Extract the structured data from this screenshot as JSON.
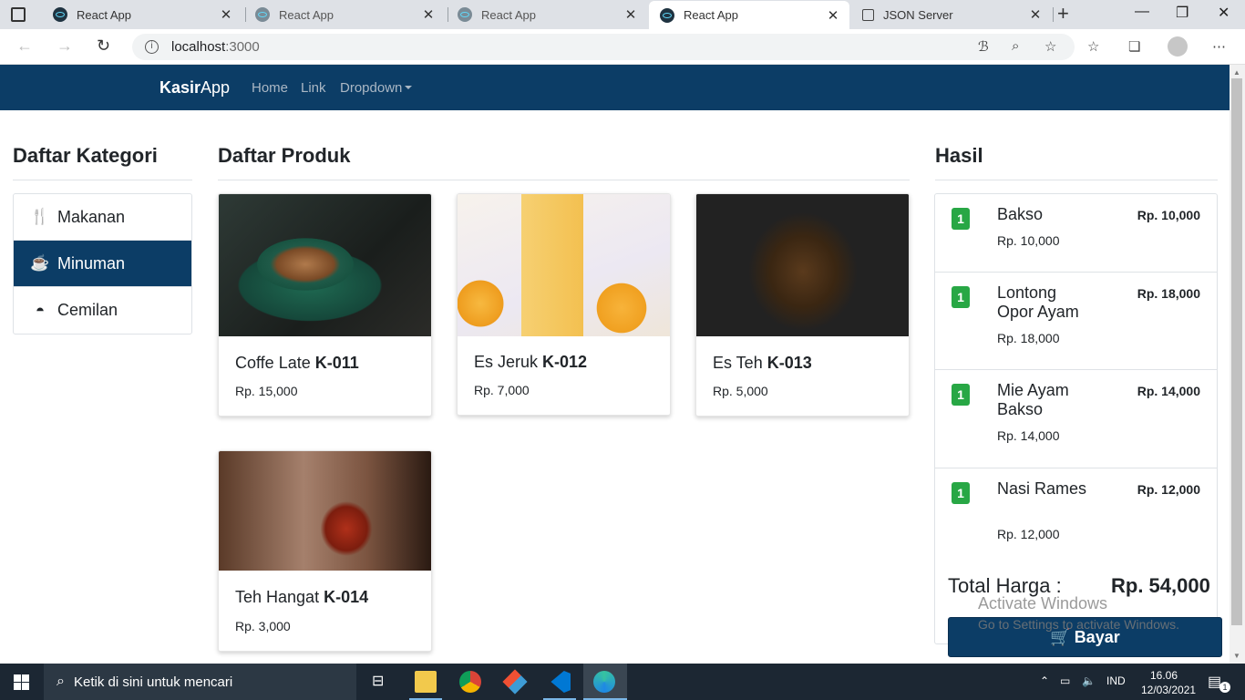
{
  "browser": {
    "tabs": [
      {
        "title": "React App"
      },
      {
        "title": "React App"
      },
      {
        "title": "React App"
      },
      {
        "title": "React App"
      },
      {
        "title": "JSON Server"
      }
    ],
    "url_host": "localhost",
    "url_port": ":3000"
  },
  "navbar": {
    "brand_bold": "Kasir",
    "brand_rest": "App",
    "links": [
      "Home",
      "Link",
      "Dropdown"
    ]
  },
  "kategori": {
    "title": "Daftar Kategori",
    "items": [
      {
        "label": "Makanan",
        "icon": "utensils-icon",
        "active": false
      },
      {
        "label": "Minuman",
        "icon": "coffee-icon",
        "active": true
      },
      {
        "label": "Cemilan",
        "icon": "cheese-icon",
        "active": false
      }
    ]
  },
  "produk": {
    "title": "Daftar Produk",
    "items": [
      {
        "name": "Coffe Late",
        "code": "K-011",
        "price": "Rp. 15,000",
        "image": "coffee-latte-image"
      },
      {
        "name": "Es Jeruk",
        "code": "K-012",
        "price": "Rp. 7,000",
        "image": "orange-juice-image"
      },
      {
        "name": "Es Teh",
        "code": "K-013",
        "price": "Rp. 5,000",
        "image": "iced-tea-image"
      },
      {
        "name": "Teh Hangat",
        "code": "K-014",
        "price": "Rp. 3,000",
        "image": "hot-tea-image"
      }
    ]
  },
  "hasil": {
    "title": "Hasil",
    "items": [
      {
        "qty": "1",
        "name": "Bakso",
        "price": "Rp. 10,000",
        "total": "Rp. 10,000"
      },
      {
        "qty": "1",
        "name": "Lontong Opor Ayam",
        "price": "Rp. 18,000",
        "total": "Rp. 18,000"
      },
      {
        "qty": "1",
        "name": "Mie Ayam Bakso",
        "price": "Rp. 14,000",
        "total": "Rp. 14,000"
      },
      {
        "qty": "1",
        "name": "Nasi Rames",
        "price": "Rp. 12,000",
        "total": "Rp. 12,000"
      }
    ],
    "total_label": "Total Harga :",
    "total_value": "Rp. 54,000",
    "button_label": "Bayar"
  },
  "watermark": {
    "line1": "Activate Windows",
    "line2": "Go to Settings to activate Windows."
  },
  "taskbar": {
    "search_placeholder": "Ketik di sini untuk mencari",
    "language": "IND",
    "time": "16.06",
    "date": "12/03/2021",
    "notification_count": "1"
  },
  "colors": {
    "navbar_bg": "#0c3d66",
    "active_category": "#0c3d66",
    "qty_badge": "#28a745"
  }
}
